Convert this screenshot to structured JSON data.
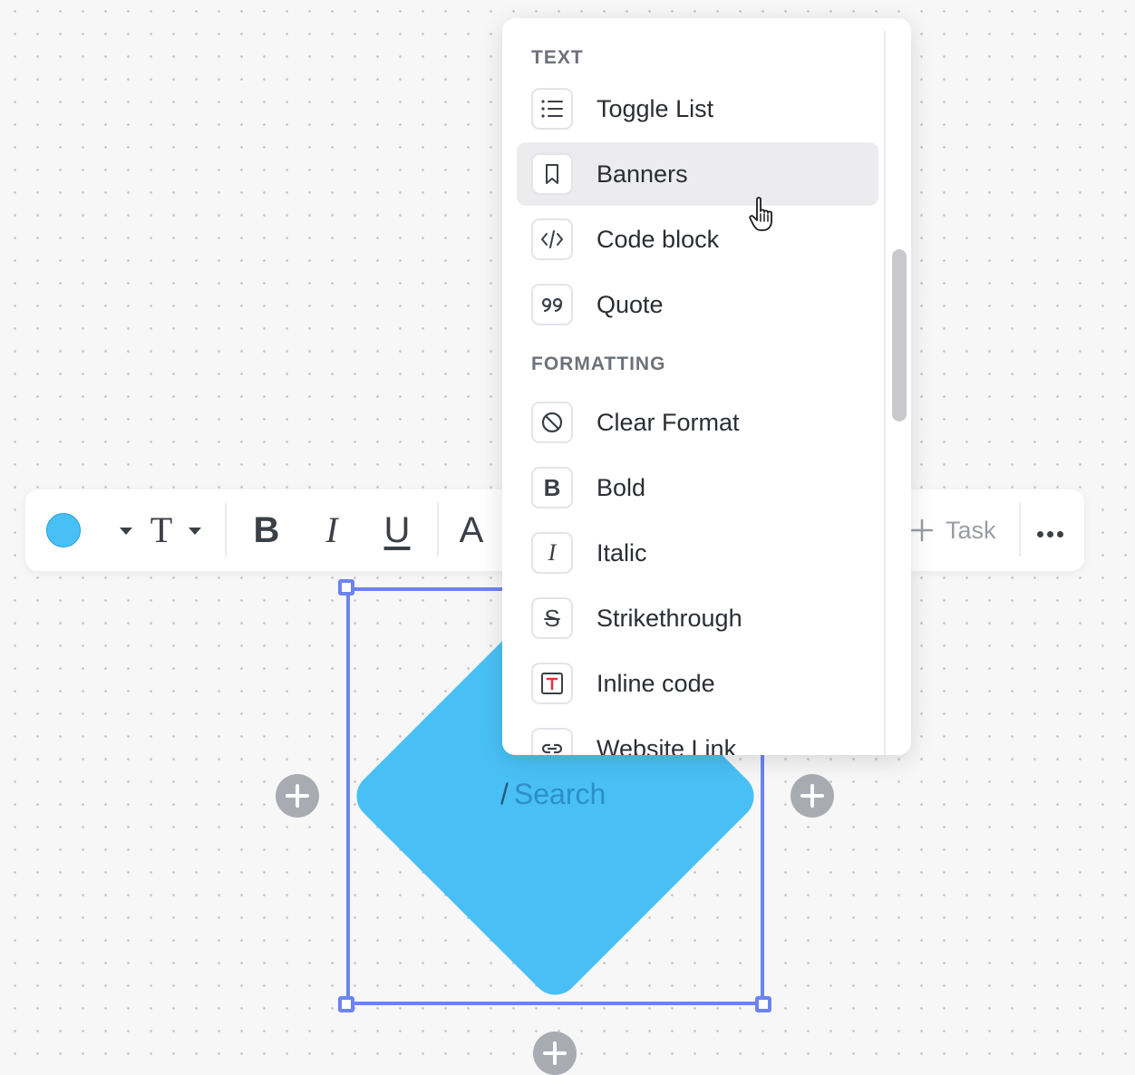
{
  "menu": {
    "sections": {
      "text": "TEXT",
      "formatting": "FORMATTING"
    },
    "items": [
      {
        "label": "Toggle List",
        "icon": "list-icon"
      },
      {
        "label": "Banners",
        "icon": "bookmark-icon"
      },
      {
        "label": "Code block",
        "icon": "code-icon"
      },
      {
        "label": "Quote",
        "icon": "quote-icon"
      },
      {
        "label": "Clear Format",
        "icon": "clear-format-icon"
      },
      {
        "label": "Bold",
        "icon": "bold-icon"
      },
      {
        "label": "Italic",
        "icon": "italic-icon"
      },
      {
        "label": "Strikethrough",
        "icon": "strikethrough-icon"
      },
      {
        "label": "Inline code",
        "icon": "inline-code-icon"
      },
      {
        "label": "Website Link",
        "icon": "link-icon"
      }
    ],
    "hovered_item": "Banners"
  },
  "toolbar": {
    "color": "#49c0f5",
    "text_glyph": "T",
    "bold_glyph": "B",
    "italic_glyph": "I",
    "underline_glyph": "U",
    "font_color_glyph": "A",
    "task_label": "Task"
  },
  "shape": {
    "color": "#49c0f5",
    "slash": "/",
    "placeholder": "Search"
  },
  "colors": {
    "selection": "#6c84f0",
    "accent_red": "#e0363b"
  }
}
